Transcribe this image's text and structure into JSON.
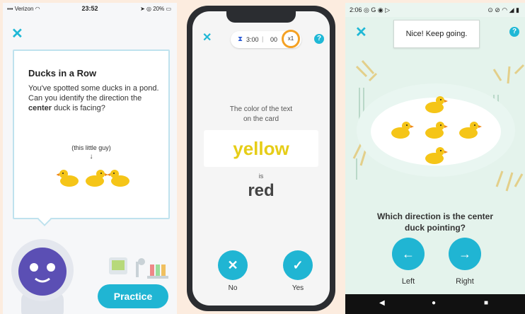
{
  "panel1": {
    "status": {
      "carrier": "Verizon",
      "time": "23:52",
      "battery": "20%"
    },
    "card": {
      "title": "Ducks in a Row",
      "body_before": "You've spotted some ducks in a pond. Can you identify the direction the ",
      "body_bold": "center",
      "body_after": " duck is facing?",
      "hint": "(this little guy)",
      "arrow": "↓"
    },
    "practice_label": "Practice"
  },
  "panel2": {
    "timer": "3:00",
    "score": "00",
    "multiplier": "x1",
    "prompt_line1": "The color of the text",
    "prompt_line2": "on the card",
    "card_word": "yellow",
    "card_word_color": "#e6cd17",
    "is_label": "is",
    "meaning_word": "red",
    "no_label": "No",
    "yes_label": "Yes"
  },
  "panel3": {
    "status": {
      "time": "2:06"
    },
    "toast": "Nice! Keep going.",
    "question_line1": "Which direction is the center",
    "question_line2": "duck pointing?",
    "left_label": "Left",
    "right_label": "Right"
  },
  "colors": {
    "accent": "#20b5d3",
    "duck": "#f5c518",
    "beak": "#f08a1c",
    "timer_ring": "#f4a124"
  }
}
